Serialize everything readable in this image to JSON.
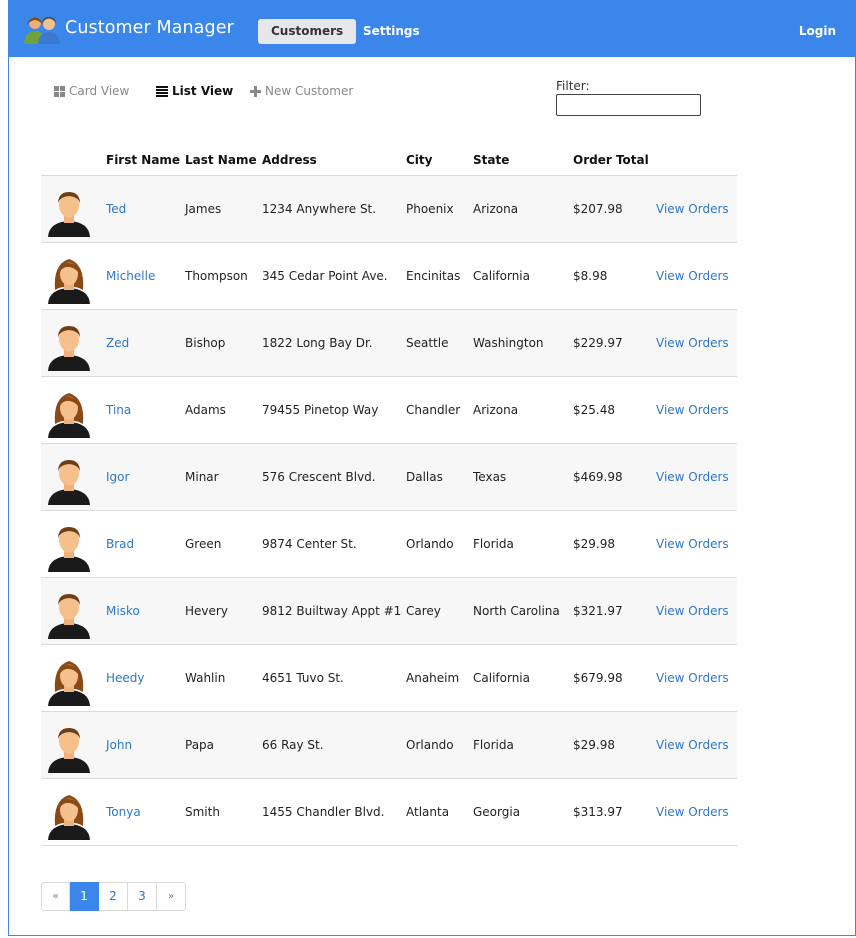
{
  "colors": {
    "brand": "#3a86ea",
    "link": "#2f78c4",
    "row_alt": "#f7f7f7"
  },
  "navbar": {
    "title": "Customer Manager",
    "tabs": [
      {
        "label": "Customers",
        "active": true
      },
      {
        "label": "Settings",
        "active": false
      }
    ],
    "login": "Login"
  },
  "toolbar": {
    "card_view": "Card View",
    "list_view": "List View",
    "new_customer": "New Customer",
    "filter_label": "Filter:",
    "filter_value": ""
  },
  "table": {
    "headers": [
      "First Name",
      "Last Name",
      "Address",
      "City",
      "State",
      "Order Total"
    ],
    "action_label": "View Orders",
    "rows": [
      {
        "first": "Ted",
        "last": "James",
        "address": "1234 Anywhere St.",
        "city": "Phoenix",
        "state": "Arizona",
        "total": "$207.98",
        "avatar": "male-avatar-icon"
      },
      {
        "first": "Michelle",
        "last": "Thompson",
        "address": "345 Cedar Point Ave.",
        "city": "Encinitas",
        "state": "California",
        "total": "$8.98",
        "avatar": "female-avatar-icon"
      },
      {
        "first": "Zed",
        "last": "Bishop",
        "address": "1822 Long Bay Dr.",
        "city": "Seattle",
        "state": "Washington",
        "total": "$229.97",
        "avatar": "male-avatar-icon"
      },
      {
        "first": "Tina",
        "last": "Adams",
        "address": "79455 Pinetop Way",
        "city": "Chandler",
        "state": "Arizona",
        "total": "$25.48",
        "avatar": "female-avatar-icon"
      },
      {
        "first": "Igor",
        "last": "Minar",
        "address": "576 Crescent Blvd.",
        "city": "Dallas",
        "state": "Texas",
        "total": "$469.98",
        "avatar": "male-avatar-icon"
      },
      {
        "first": "Brad",
        "last": "Green",
        "address": "9874 Center St.",
        "city": "Orlando",
        "state": "Florida",
        "total": "$29.98",
        "avatar": "male-avatar-icon"
      },
      {
        "first": "Misko",
        "last": "Hevery",
        "address": "9812 Builtway Appt #1",
        "city": "Carey",
        "state": "North Carolina",
        "total": "$321.97",
        "avatar": "male-avatar-icon"
      },
      {
        "first": "Heedy",
        "last": "Wahlin",
        "address": "4651 Tuvo St.",
        "city": "Anaheim",
        "state": "California",
        "total": "$679.98",
        "avatar": "female-avatar-icon"
      },
      {
        "first": "John",
        "last": "Papa",
        "address": "66 Ray St.",
        "city": "Orlando",
        "state": "Florida",
        "total": "$29.98",
        "avatar": "male-avatar-icon"
      },
      {
        "first": "Tonya",
        "last": "Smith",
        "address": "1455 Chandler Blvd.",
        "city": "Atlanta",
        "state": "Georgia",
        "total": "$313.97",
        "avatar": "female-avatar-icon"
      }
    ]
  },
  "pagination": {
    "prev": "«",
    "next": "»",
    "pages": [
      "1",
      "2",
      "3"
    ],
    "current": "1"
  }
}
